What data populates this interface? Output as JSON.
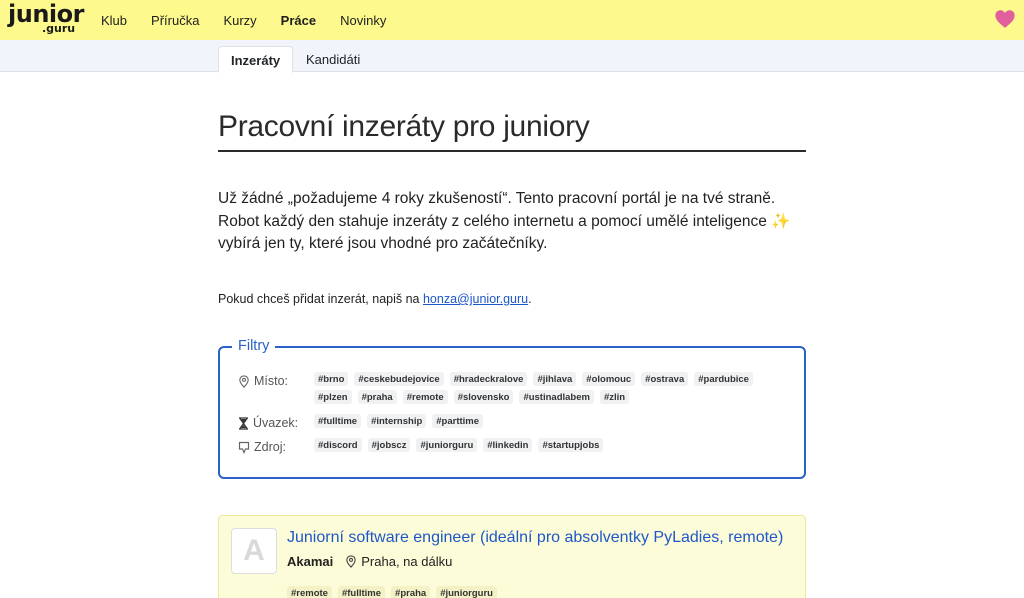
{
  "logo": {
    "main": "junior",
    "sub": ".guru"
  },
  "nav": {
    "items": [
      {
        "label": "Klub"
      },
      {
        "label": "Příručka"
      },
      {
        "label": "Kurzy"
      },
      {
        "label": "Práce"
      },
      {
        "label": "Novinky"
      }
    ],
    "active": "Práce",
    "heart_icon": "heart-icon",
    "heart_color": "#e05f9c"
  },
  "subnav": {
    "tabs": [
      {
        "label": "Inzeráty"
      },
      {
        "label": "Kandidáti"
      }
    ],
    "active": "Inzeráty"
  },
  "page": {
    "title": "Pracovní inzeráty pro juniory",
    "lead": "Už žádné „požadujeme 4 roky zkušeností“. Tento pracovní portál je na tvé straně. Robot každý den stahuje inzeráty z celého internetu a pomocí umělé inteligence ✨ vybírá jen ty, které jsou vhodné pro začátečníky.",
    "note_prefix": "Pokud chceš přidat inzerát, napiš na ",
    "note_email": "honza@junior.guru",
    "note_suffix": "."
  },
  "filters": {
    "legend": "Filtry",
    "misto": {
      "label": "Místo:",
      "icon": "location-pin-icon",
      "tags": [
        "#brno",
        "#ceskebudejovice",
        "#hradeckralove",
        "#jihlava",
        "#olomouc",
        "#ostrava",
        "#pardubice",
        "#plzen",
        "#praha",
        "#remote",
        "#slovensko",
        "#ustinadlabem",
        "#zlin"
      ]
    },
    "uvazek": {
      "label": "Úvazek:",
      "icon": "hourglass-icon",
      "tags": [
        "#fulltime",
        "#internship",
        "#parttime"
      ]
    },
    "zdroj": {
      "label": "Zdroj:",
      "icon": "source-icon",
      "tags": [
        "#discord",
        "#jobscz",
        "#juniorguru",
        "#linkedin",
        "#startupjobs"
      ]
    }
  },
  "jobs": [
    {
      "logo_letter": "A",
      "title": "Juniorní software engineer (ideální pro absolventky PyLadies, remote)",
      "company": "Akamai",
      "location": "Praha, na dálku",
      "tags": [
        "#remote",
        "#fulltime",
        "#praha",
        "#juniorguru"
      ]
    }
  ],
  "colors": {
    "nav_bg": "#fdf98d",
    "accent": "#2a62c7",
    "link": "#1d57c9",
    "job_bg": "#fdfcd8"
  }
}
